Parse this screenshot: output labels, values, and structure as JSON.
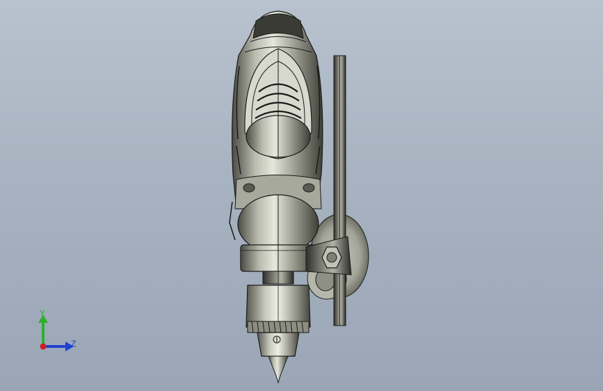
{
  "viewport": {
    "background_top": "#b8c2cf",
    "background_bottom": "#9aa6b6"
  },
  "model": {
    "body_color": "#8d8f84",
    "edge_color": "#1a1a1a",
    "highlight_color": "#e8e8e0"
  },
  "triad": {
    "y_label": "Y",
    "z_label": "Z",
    "colors": {
      "y": "#2fb02f",
      "z": "#2040d0",
      "x": "#d02020"
    }
  }
}
